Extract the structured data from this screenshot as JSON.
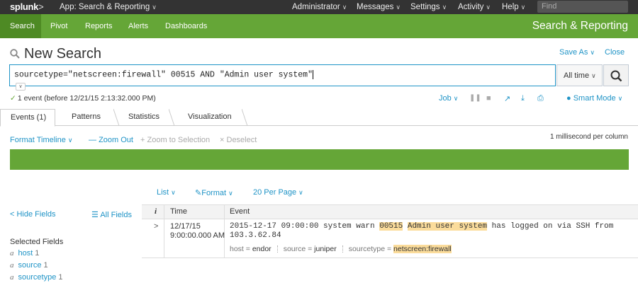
{
  "topbar": {
    "logo": "splunk",
    "logo_suffix": ">",
    "app_menu": "App: Search & Reporting",
    "nav": [
      "Administrator",
      "Messages",
      "Settings",
      "Activity",
      "Help"
    ],
    "find_placeholder": "Find"
  },
  "appbar": {
    "nav": [
      "Search",
      "Pivot",
      "Reports",
      "Alerts",
      "Dashboards"
    ],
    "active": "Search",
    "title": "Search & Reporting",
    "color": "#65a637"
  },
  "page": {
    "title": "New Search",
    "save_as": "Save As",
    "close": "Close"
  },
  "search": {
    "query": "sourcetype=\"netscreen:firewall\" 00515 AND \"Admin user system\"",
    "time_range": "All time"
  },
  "status": {
    "text": "1 event (before 12/21/15 2:13:32.000 PM)",
    "job": "Job",
    "mode": "Smart Mode"
  },
  "tabs": [
    "Events (1)",
    "Patterns",
    "Statistics",
    "Visualization"
  ],
  "timeline": {
    "format": "Format Timeline",
    "zoom_out": "Zoom Out",
    "zoom_selection": "Zoom to Selection",
    "deselect": "Deselect",
    "scale": "1 millisecond per column"
  },
  "list_controls": {
    "list": "List",
    "format": "Format",
    "per_page": "20 Per Page"
  },
  "sidebar": {
    "hide_fields": "< Hide Fields",
    "all_fields": "All Fields",
    "selected_heading": "Selected Fields",
    "fields": [
      {
        "type": "a",
        "name": "host",
        "count": "1"
      },
      {
        "type": "a",
        "name": "source",
        "count": "1"
      },
      {
        "type": "a",
        "name": "sourcetype",
        "count": "1"
      }
    ]
  },
  "table": {
    "headers": [
      "i",
      "Time",
      "Event"
    ],
    "rows": [
      {
        "expand": ">",
        "date": "12/17/15",
        "time": "9:00:00.000 AM",
        "event_pre": "2015-12-17 09:00:00 system warn ",
        "event_hl1": "00515",
        "event_mid": " ",
        "event_hl2": "Admin user system",
        "event_post": " has logged on via SSH from 103.3.62.84",
        "host_label": "host = ",
        "host": "endor",
        "source_label": "source = ",
        "source": "juniper",
        "sourcetype_label": "sourcetype = ",
        "sourcetype": "netscreen:firewall"
      }
    ]
  }
}
